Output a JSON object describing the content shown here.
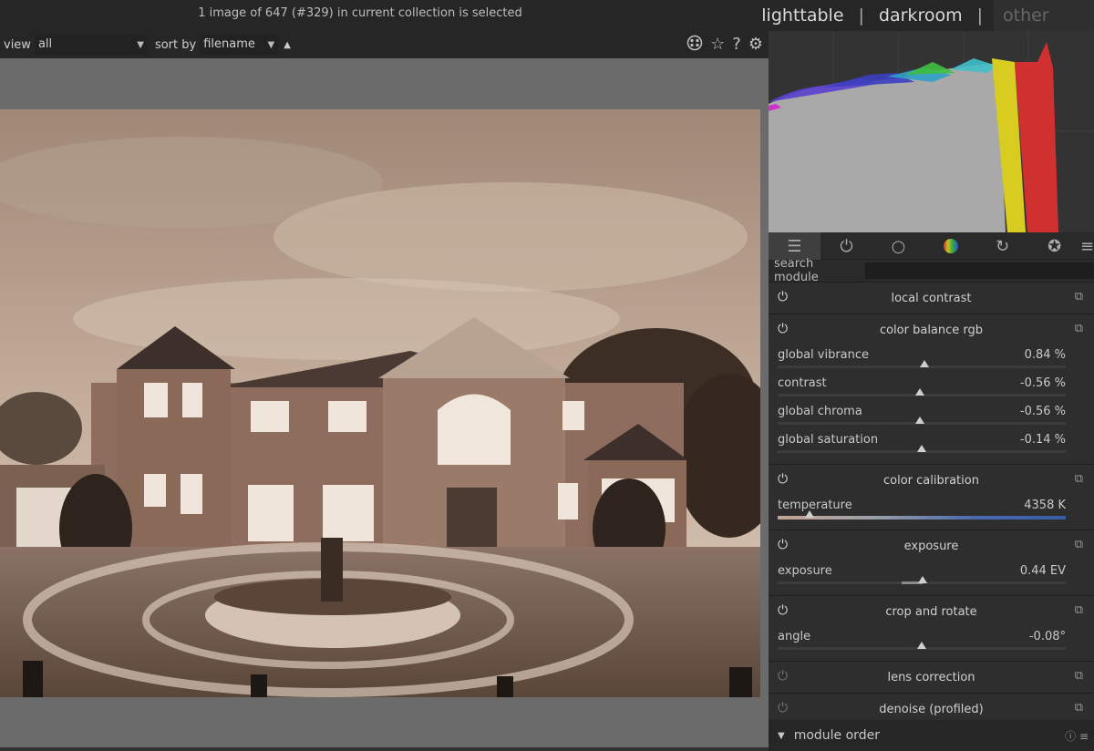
{
  "header": {
    "status": "1 image of 647 (#329) in current collection is selected",
    "views": [
      "lighttable",
      "darkroom",
      "other"
    ],
    "separator": "|"
  },
  "filterbar": {
    "view_label": "view",
    "view_value": "all",
    "sort_label": "sort by",
    "sort_value": "filename",
    "icons": [
      "presets-icon",
      "star-icon",
      "help-icon",
      "gear-icon"
    ]
  },
  "panel": {
    "tabs": [
      "sliders-icon",
      "power-icon",
      "circle-icon",
      "color-wheel-icon",
      "refresh-icon",
      "lens-icon",
      "menu-icon"
    ],
    "search_label": "search module",
    "search_value": "",
    "modules": [
      {
        "name": "local contrast",
        "on": true
      },
      {
        "name": "color balance rgb",
        "on": true,
        "sliders": [
          {
            "label": "global vibrance",
            "value": "0.84 %",
            "pos": 0.51
          },
          {
            "label": "contrast",
            "value": "-0.56 %",
            "pos": 0.495
          },
          {
            "label": "global chroma",
            "value": "-0.56 %",
            "pos": 0.495
          },
          {
            "label": "global saturation",
            "value": "-0.14 %",
            "pos": 0.499
          }
        ]
      },
      {
        "name": "color calibration",
        "on": true,
        "sliders": [
          {
            "label": "temperature",
            "value": "4358 K",
            "pos": 0.11
          }
        ]
      },
      {
        "name": "exposure",
        "on": true,
        "sliders": [
          {
            "label": "exposure",
            "value": "0.44 EV",
            "pos": 0.502
          }
        ]
      },
      {
        "name": "crop and rotate",
        "on": true,
        "sliders": [
          {
            "label": "angle",
            "value": "-0.08°",
            "pos": 0.499
          }
        ]
      },
      {
        "name": "lens correction",
        "on": false
      },
      {
        "name": "denoise (profiled)",
        "on": false
      }
    ],
    "module_order": "module order"
  }
}
